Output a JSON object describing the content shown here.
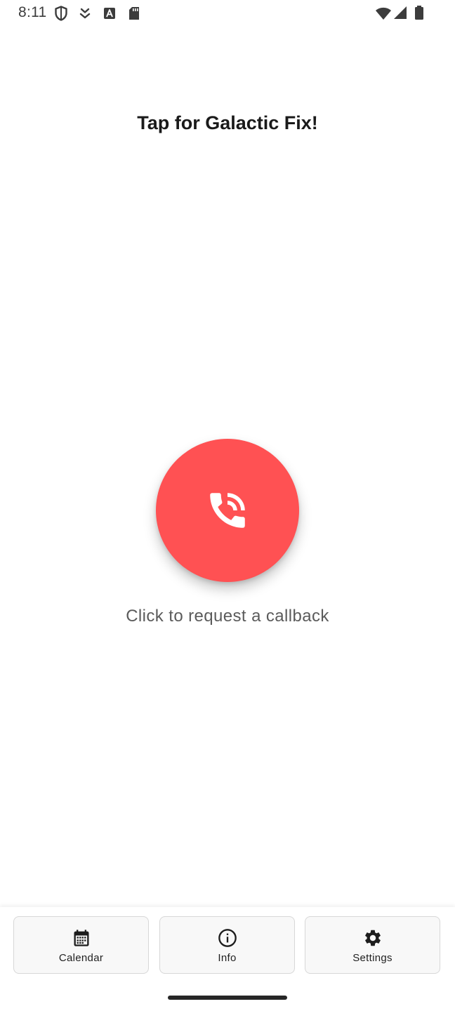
{
  "status_bar": {
    "time": "8:11",
    "icons": [
      "shield-icon",
      "download-icon",
      "keyboard-a-icon",
      "sd-card-icon",
      "wifi-icon",
      "cellular-signal-icon",
      "battery-icon"
    ]
  },
  "page": {
    "title": "Tap for Galactic Fix!"
  },
  "call": {
    "icon": "phone-callback-icon",
    "button_color": "#ff5153",
    "hint": "Click to request a callback"
  },
  "bottom_nav": {
    "items": [
      {
        "label": "Calendar",
        "icon": "calendar-icon"
      },
      {
        "label": "Info",
        "icon": "info-icon"
      },
      {
        "label": "Settings",
        "icon": "settings-gear-icon"
      }
    ]
  }
}
